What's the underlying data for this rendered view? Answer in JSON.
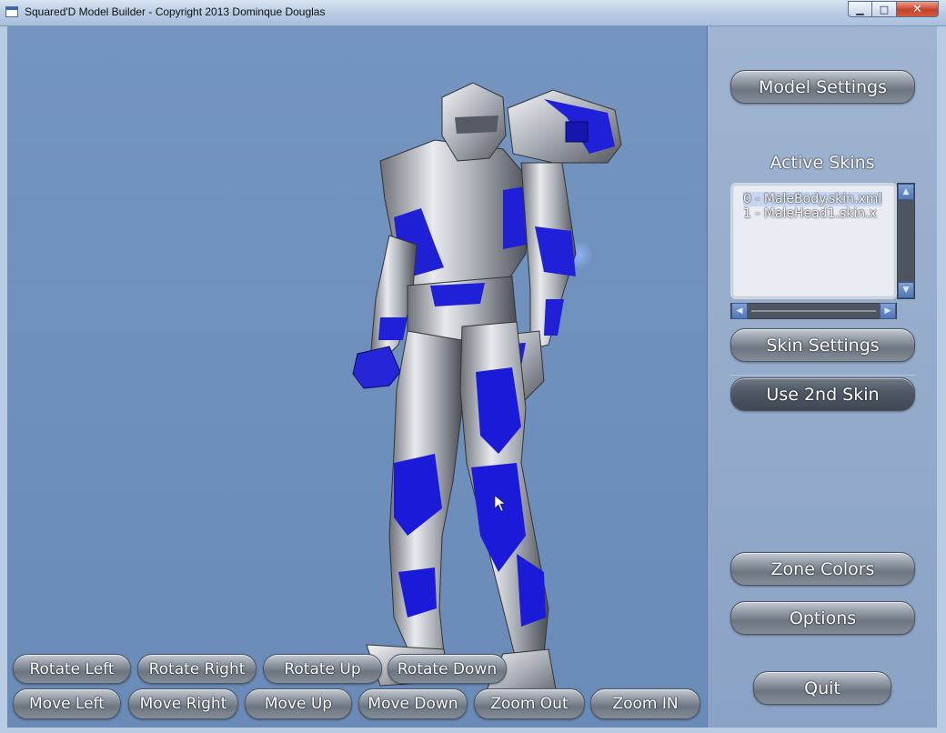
{
  "window": {
    "title": "Squared'D Model Builder - Copyright 2013 Dominque Douglas",
    "minimize_glyph": "▁",
    "maximize_glyph": "□",
    "close_glyph": "✕"
  },
  "side_panel": {
    "model_settings": "Model Settings",
    "active_skins_label": "Active Skins",
    "skins": [
      "0 - MaleBody.skin.xml",
      "1 - MaleHead1.skin.x"
    ],
    "skin_settings": "Skin Settings",
    "use_2nd_skin": "Use 2nd Skin",
    "zone_colors": "Zone Colors",
    "options": "Options",
    "quit": "Quit"
  },
  "scroll_glyphs": {
    "up": "▲",
    "down": "▼",
    "left": "◀",
    "right": "▶"
  },
  "controls": {
    "rotate_left": "Rotate Left",
    "rotate_right": "Rotate Right",
    "rotate_up": "Rotate Up",
    "rotate_down": "Rotate Down",
    "move_left": "Move Left",
    "move_right": "Move Right",
    "move_up": "Move Up",
    "move_down": "Move Down",
    "zoom_out": "Zoom Out",
    "zoom_in": "Zoom IN"
  },
  "colors": {
    "viewport_bg": "#7393bf",
    "armor_blue": "#1a1ad8",
    "armor_silver": "#c9ccd3"
  }
}
